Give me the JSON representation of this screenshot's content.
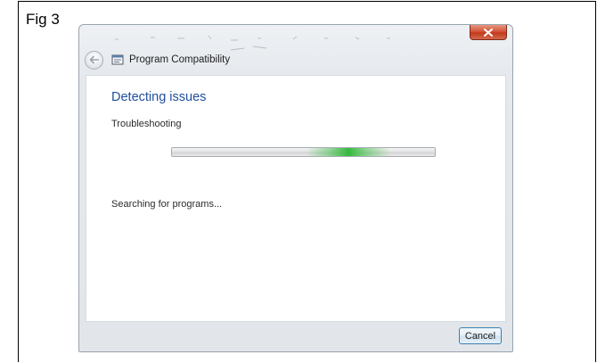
{
  "figure": {
    "label": "Fig 3"
  },
  "window": {
    "title": "Program Compatibility",
    "close_icon": "close-icon",
    "back_icon": "back-arrow-icon",
    "app_icon": "program-compatibility-icon"
  },
  "content": {
    "heading": "Detecting issues",
    "subheading": "Troubleshooting",
    "progress": {
      "state": "indeterminate",
      "marquee_position": 0.67,
      "color": "#35b93d"
    },
    "status": "Searching for programs..."
  },
  "footer": {
    "cancel_label": "Cancel"
  },
  "colors": {
    "heading": "#1e4f9c",
    "close_button": "#c23a1d",
    "button_border": "#3c7fb1"
  }
}
